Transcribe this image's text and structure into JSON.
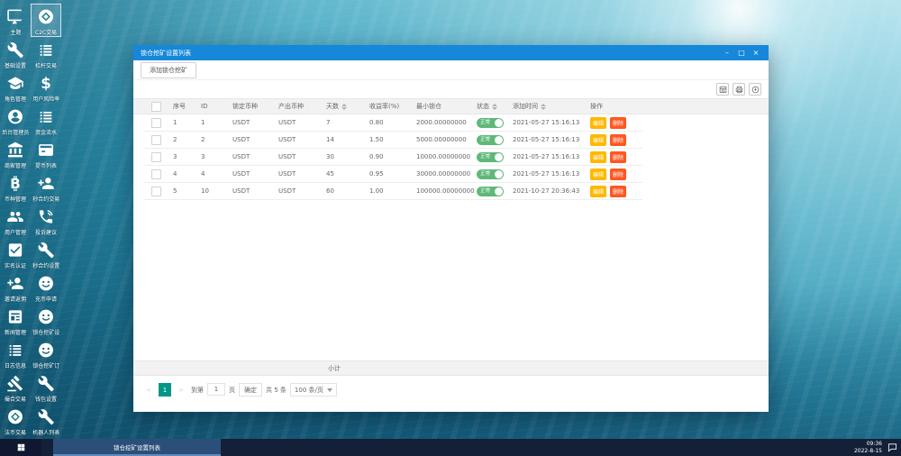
{
  "colors": {
    "titlebar": "#1687d9",
    "toggle_on": "#5FB878",
    "edit_button": "#FFB800",
    "delete_button": "#FF5722",
    "page_active": "#009688"
  },
  "desktop": {
    "icons": [
      {
        "label": "主题",
        "icon": "monitor-icon",
        "selected": false
      },
      {
        "label": "C2C交易",
        "icon": "gem-icon",
        "selected": true
      },
      {
        "label": "基础设置",
        "icon": "wrench-icon",
        "selected": false
      },
      {
        "label": "杠杆交易",
        "icon": "list-icon",
        "selected": false
      },
      {
        "label": "角色管理",
        "icon": "graduation-cap-icon",
        "selected": false
      },
      {
        "label": "用户风险率",
        "icon": "dollar-icon",
        "selected": false
      },
      {
        "label": "后台管理员",
        "icon": "user-circle-icon",
        "selected": false
      },
      {
        "label": "资金流水",
        "icon": "list-icon",
        "selected": false
      },
      {
        "label": "商家管理",
        "icon": "bank-icon",
        "selected": false
      },
      {
        "label": "提币列表",
        "icon": "card-icon",
        "selected": false
      },
      {
        "label": "币种管理",
        "icon": "bitcoin-icon",
        "selected": false
      },
      {
        "label": "秒合约交易",
        "icon": "user-plus-icon",
        "selected": false
      },
      {
        "label": "用户管理",
        "icon": "people-icon",
        "selected": false
      },
      {
        "label": "投诉建议",
        "icon": "phone-icon",
        "selected": false
      },
      {
        "label": "实名认证",
        "icon": "check-square-icon",
        "selected": false
      },
      {
        "label": "秒合约设置",
        "icon": "wrench-icon",
        "selected": false
      },
      {
        "label": "邀请返佣",
        "icon": "user-plus-icon",
        "selected": false
      },
      {
        "label": "充币申请",
        "icon": "coin-face-icon",
        "selected": false
      },
      {
        "label": "新闻管理",
        "icon": "news-icon",
        "selected": false
      },
      {
        "label": "锁仓挖矿设",
        "icon": "coin-face-icon",
        "selected": false
      },
      {
        "label": "日志信息",
        "icon": "list-icon",
        "selected": false
      },
      {
        "label": "锁仓挖矿订",
        "icon": "coin-face-icon",
        "selected": false
      },
      {
        "label": "撮合交易",
        "icon": "gavel-icon",
        "selected": false
      },
      {
        "label": "钱包设置",
        "icon": "wrench-icon",
        "selected": false
      },
      {
        "label": "法币交易",
        "icon": "gem-icon",
        "selected": false
      },
      {
        "label": "机器人列表",
        "icon": "wrench-icon",
        "selected": false
      }
    ],
    "taskbar": {
      "active_task": "锁仓挖矿设置列表",
      "clock_time": "09:36",
      "clock_date": "2022-8-15"
    }
  },
  "window": {
    "title": "锁仓挖矿设置列表",
    "controls": {
      "minimize": "–",
      "maximize": "□",
      "close": "×"
    },
    "toolbar": {
      "add_button": "添加锁仓挖矿"
    },
    "table": {
      "tools": [
        "filter-columns-icon",
        "print-icon",
        "export-icon"
      ],
      "columns": [
        {
          "label": "序号",
          "sortable": false
        },
        {
          "label": "ID",
          "sortable": false
        },
        {
          "label": "锁定币种",
          "sortable": false
        },
        {
          "label": "产出币种",
          "sortable": false
        },
        {
          "label": "天数",
          "sortable": true
        },
        {
          "label": "收益率(%)",
          "sortable": false
        },
        {
          "label": "最小锁仓",
          "sortable": false
        },
        {
          "label": "状态",
          "sortable": true
        },
        {
          "label": "添加时间",
          "sortable": true
        },
        {
          "label": "操作",
          "sortable": false
        }
      ],
      "rows": [
        {
          "seq": "1",
          "id": "1",
          "lock_coin": "USDT",
          "out_coin": "USDT",
          "days": "7",
          "rate": "0.80",
          "min_lock": "2000.00000000",
          "status": "正常",
          "added": "2021-05-27 15:16:13"
        },
        {
          "seq": "2",
          "id": "2",
          "lock_coin": "USDT",
          "out_coin": "USDT",
          "days": "14",
          "rate": "1.50",
          "min_lock": "5000.00000000",
          "status": "正常",
          "added": "2021-05-27 15:16:13"
        },
        {
          "seq": "3",
          "id": "3",
          "lock_coin": "USDT",
          "out_coin": "USDT",
          "days": "30",
          "rate": "0.90",
          "min_lock": "10000.00000000",
          "status": "正常",
          "added": "2021-05-27 15:16:13"
        },
        {
          "seq": "4",
          "id": "4",
          "lock_coin": "USDT",
          "out_coin": "USDT",
          "days": "45",
          "rate": "0.95",
          "min_lock": "30000.00000000",
          "status": "正常",
          "added": "2021-05-27 15:16:13"
        },
        {
          "seq": "5",
          "id": "10",
          "lock_coin": "USDT",
          "out_coin": "USDT",
          "days": "60",
          "rate": "1.00",
          "min_lock": "100000.00000000",
          "status": "正常",
          "added": "2021-10-27 20:36:43"
        }
      ],
      "row_actions": {
        "edit": "编辑",
        "delete": "删除"
      },
      "summary_label": "小计"
    },
    "pagination": {
      "prev": "<",
      "page": "1",
      "next": ">",
      "goto_prefix": "到第",
      "goto_value": "1",
      "goto_suffix": "页",
      "confirm": "确定",
      "total": "共 5 条",
      "page_size": "100 条/页"
    }
  }
}
